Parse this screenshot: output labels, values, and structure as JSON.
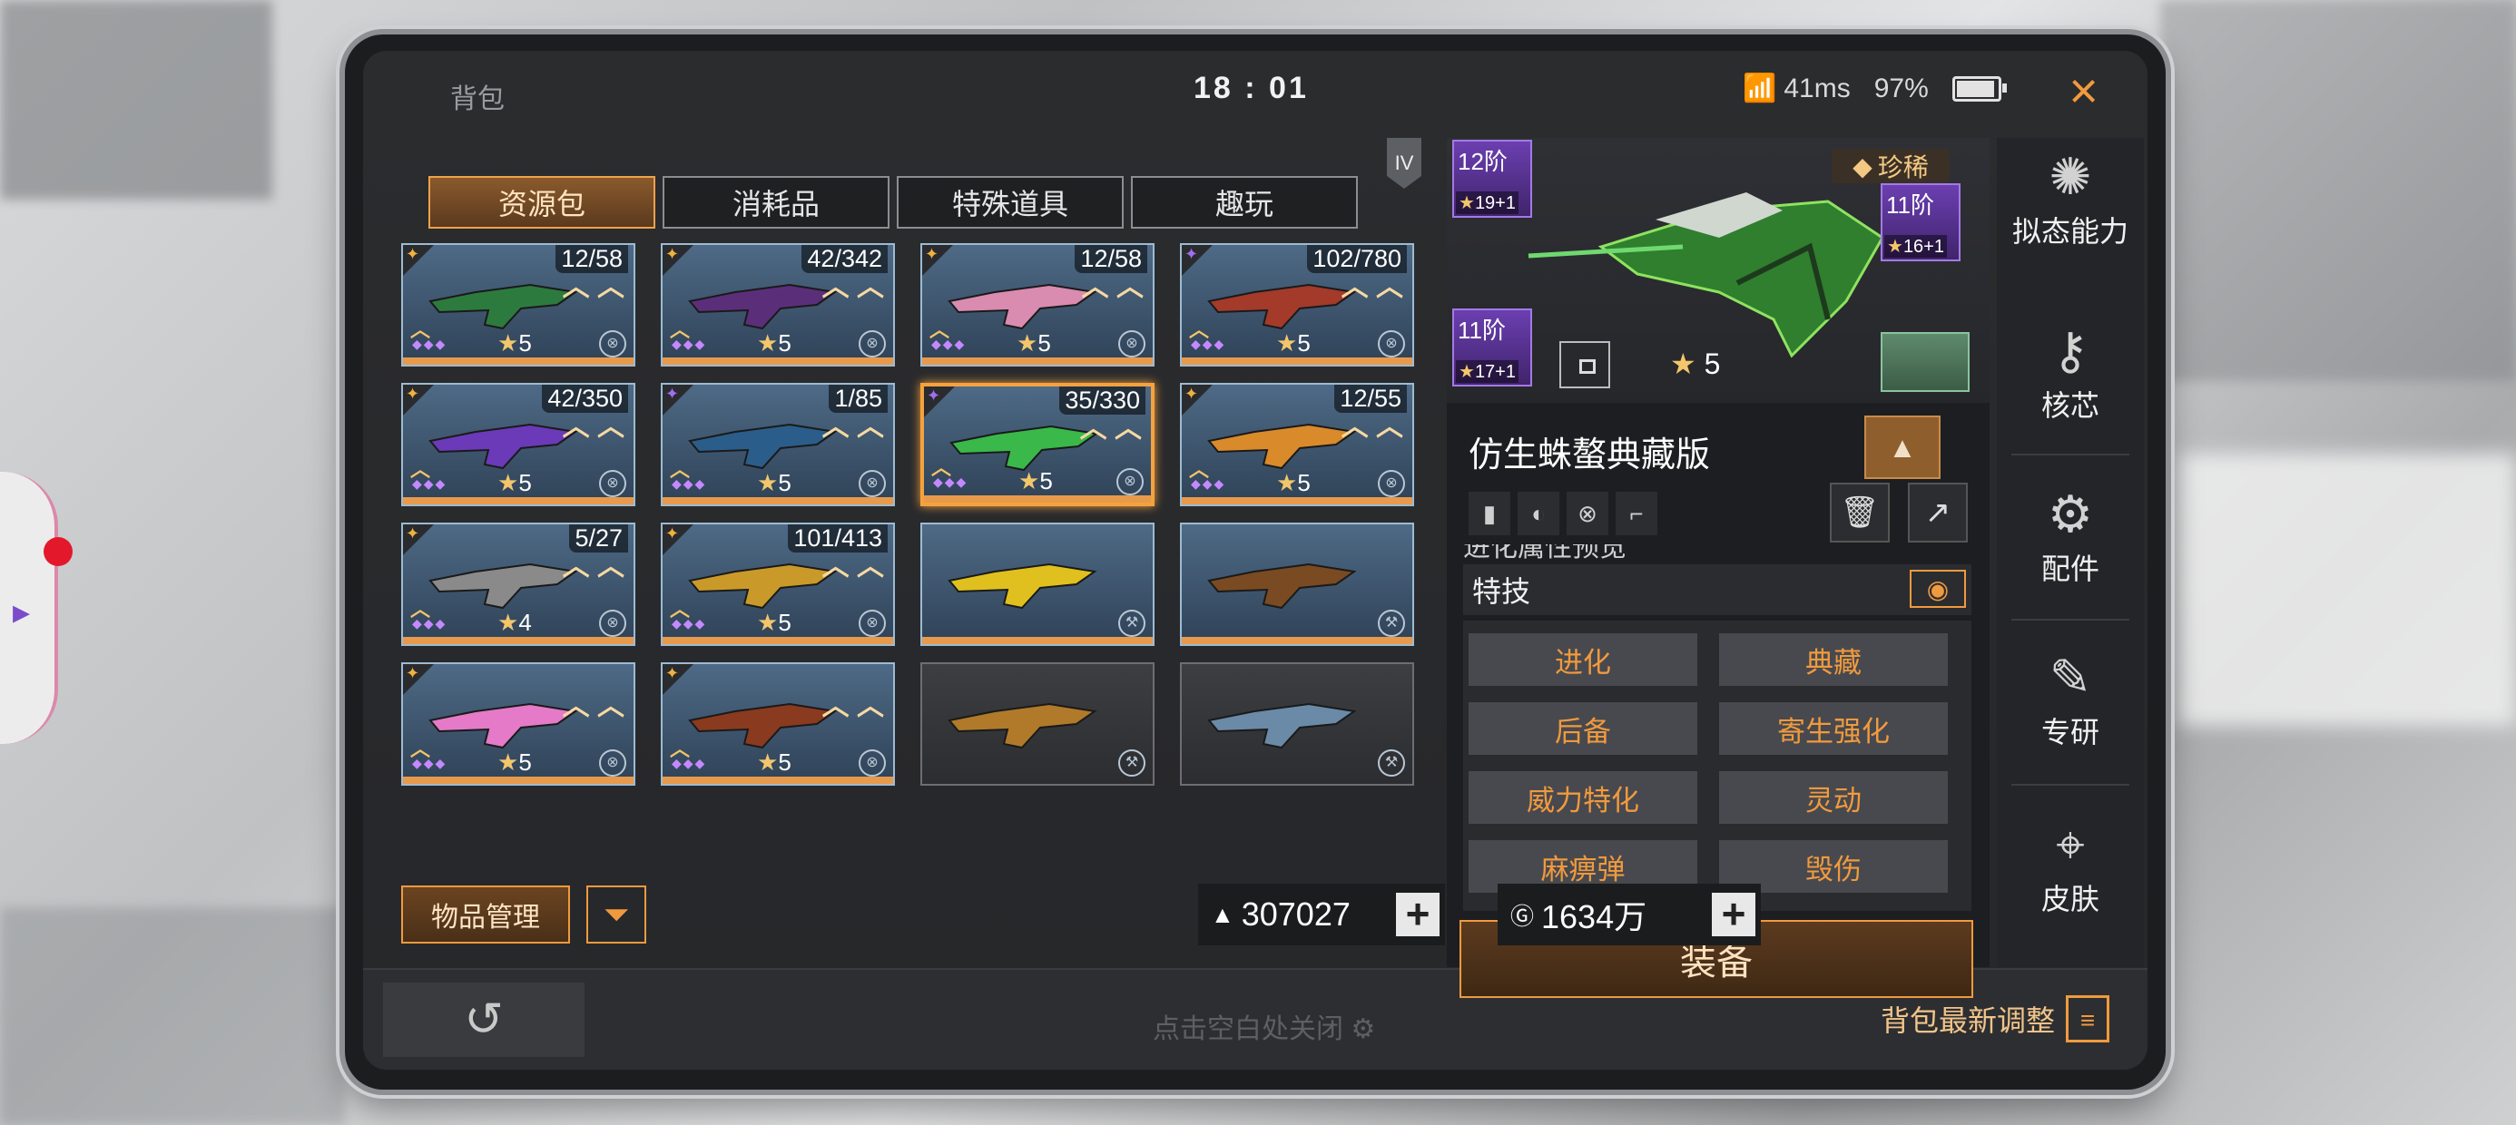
{
  "topbar": {
    "title": "背包",
    "clock": "18 : 01",
    "ping": "41ms",
    "battery": "97%",
    "close_icon": "×"
  },
  "tier_badge": "IV",
  "tabs": [
    {
      "label": "资源包",
      "active": true
    },
    {
      "label": "消耗品",
      "active": false
    },
    {
      "label": "特殊道具",
      "active": false
    },
    {
      "label": "趣玩",
      "active": false
    }
  ],
  "items": [
    {
      "count": "12/58",
      "stars": "5",
      "rarity": "gold",
      "color": "#2d7a3e"
    },
    {
      "count": "42/342",
      "stars": "5",
      "rarity": "gold",
      "color": "#5b2e7a"
    },
    {
      "count": "12/58",
      "stars": "5",
      "rarity": "gold",
      "color": "#d98bb0"
    },
    {
      "count": "102/780",
      "stars": "5",
      "rarity": "purple",
      "color": "#a33a2a"
    },
    {
      "count": "42/350",
      "stars": "5",
      "rarity": "gold",
      "color": "#6a3ab8"
    },
    {
      "count": "1/85",
      "stars": "5",
      "rarity": "purple",
      "color": "#2b5d8a"
    },
    {
      "count": "35/330",
      "stars": "5",
      "rarity": "purple",
      "color": "#3ab84a",
      "selected": true
    },
    {
      "count": "12/55",
      "stars": "5",
      "rarity": "gold",
      "color": "#d98a2b"
    },
    {
      "count": "5/27",
      "stars": "4",
      "rarity": "gold",
      "color": "#8a8a8a"
    },
    {
      "count": "101/413",
      "stars": "5",
      "rarity": "gold",
      "color": "#c99a2a"
    },
    {
      "count": "",
      "stars": "",
      "rarity": "",
      "color": "#e0c01e"
    },
    {
      "count": "",
      "stars": "",
      "rarity": "",
      "color": "#7a4a22"
    },
    {
      "count": "",
      "stars": "5",
      "rarity": "gold",
      "color": "#e47ac8"
    },
    {
      "count": "",
      "stars": "5",
      "rarity": "gold",
      "color": "#8a3a1e"
    },
    {
      "count": "",
      "stars": "",
      "rarity": "",
      "color": "#b07a2a"
    },
    {
      "count": "",
      "stars": "",
      "rarity": "",
      "color": "#6a8aa8"
    }
  ],
  "bottom": {
    "manage_label": "物品管理",
    "filter_icon": "filter-icon",
    "currency1": "307027",
    "currency2": "1634万",
    "plus": "+"
  },
  "footer": {
    "back_icon": "↺",
    "hint": "点击空白处关闭",
    "latest": "背包最新调整"
  },
  "detail": {
    "rarity_label": "珍稀",
    "mods": [
      {
        "level": "12阶",
        "stars": "19+1"
      },
      {
        "level": "11阶",
        "stars": "16+1"
      },
      {
        "level": "11阶",
        "stars": "17+1"
      }
    ],
    "stars": "5",
    "weapon_name": "仿生蛛螯典藏版",
    "partial_row": "进化属性预览",
    "skills_title": "特技",
    "skills": [
      "进化",
      "典藏",
      "后备",
      "寄生强化",
      "威力特化",
      "灵动",
      "麻痹弹",
      "毁伤"
    ],
    "equip_label": "装备"
  },
  "sidenav": [
    {
      "label": "拟态能力",
      "icon": "mimic-icon"
    },
    {
      "label": "核芯",
      "icon": "core-icon"
    },
    {
      "label": "配件",
      "icon": "attachment-icon"
    },
    {
      "label": "专研",
      "icon": "research-icon"
    },
    {
      "label": "皮肤",
      "icon": "skin-icon"
    }
  ],
  "element_icons": [
    "🔥",
    "❄",
    "⚡",
    "💧"
  ]
}
